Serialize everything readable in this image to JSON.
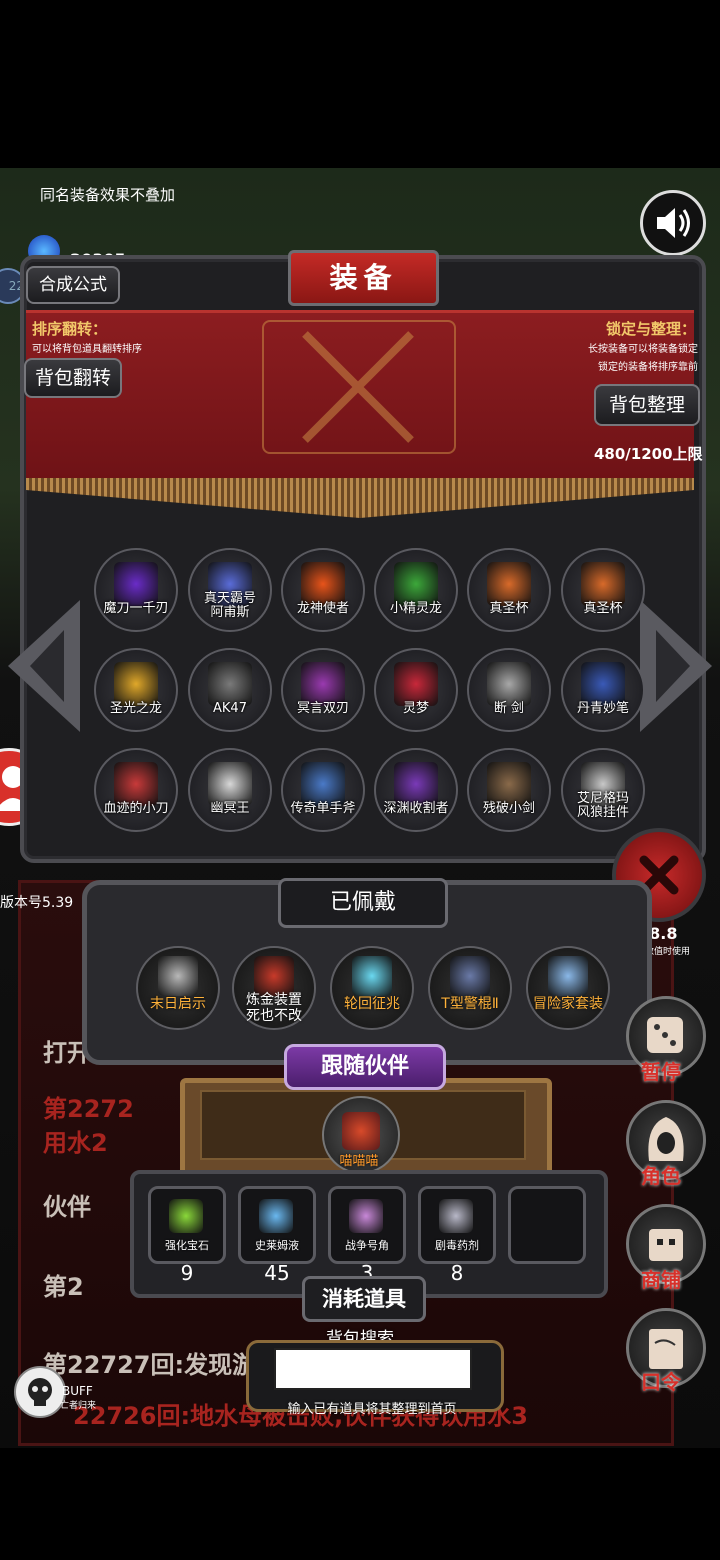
{
  "top_note": "同名装备效果不叠加",
  "currency": "20305",
  "level_badge": "22",
  "title": "装备",
  "buttons": {
    "recipe": "合成公式",
    "flip": "背包翻转",
    "tidy": "背包整理"
  },
  "sort_help": {
    "heading": "排序翻转：",
    "text": "可以将背包道具翻转排序"
  },
  "lock_help": {
    "heading": "锁定与整理：",
    "line1": "长按装备可以将装备锁定",
    "line2": "锁定的装备将排序靠前"
  },
  "capacity": "480/1200上限",
  "items": [
    {
      "name": "魔刀一千刃",
      "color": "#6a2cc8"
    },
    {
      "name": "真天霸号\n阿甫斯",
      "color": "#5a6cd8"
    },
    {
      "name": "龙神使者",
      "color": "#e8541a"
    },
    {
      "name": "小精灵龙",
      "color": "#3ca83a"
    },
    {
      "name": "真圣杯",
      "color": "#d86a2a"
    },
    {
      "name": "真圣杯",
      "color": "#d86a2a"
    },
    {
      "name": "圣光之龙",
      "color": "#e0a82a"
    },
    {
      "name": "AK47",
      "color": "#7a7a7a"
    },
    {
      "name": "冥言双刃",
      "color": "#9a3ab0"
    },
    {
      "name": "灵梦",
      "color": "#c8283a"
    },
    {
      "name": "断 剑",
      "color": "#a8a8a8"
    },
    {
      "name": "丹青妙笔",
      "color": "#3a5ab8"
    },
    {
      "name": "血迹的小刀",
      "color": "#c83a3a"
    },
    {
      "name": "幽冥王",
      "color": "#d8d8d8"
    },
    {
      "name": "传奇单手斧",
      "color": "#4a7ac8"
    },
    {
      "name": "深渊收割者",
      "color": "#7a3ab8"
    },
    {
      "name": "残破小剑",
      "color": "#8a6a4a"
    },
    {
      "name": "艾尼格玛\n风狼挂件",
      "color": "#c8c8c8"
    }
  ],
  "version": "版本号5.39",
  "worn": {
    "title": "已佩戴",
    "items": [
      {
        "name": "末日启示",
        "color": "#b8b8b8"
      },
      {
        "name": "炼金装置\n死也不改",
        "color": "#c83a2a"
      },
      {
        "name": "轮回征兆",
        "color": "#6ad8f0"
      },
      {
        "name": "T型警棍Ⅱ",
        "color": "#6a7aa8"
      },
      {
        "name": "冒险家套装",
        "color": "#8ab8e8"
      }
    ]
  },
  "partner": {
    "title": "跟随伙伴",
    "name": "喵喵喵"
  },
  "consumables": {
    "title": "消耗道具",
    "items": [
      {
        "name": "强化宝石",
        "count": "9",
        "color": "#8ad83a"
      },
      {
        "name": "史莱姆液",
        "count": "45",
        "color": "#6ab8f0"
      },
      {
        "name": "战争号角",
        "count": "3",
        "color": "#c888d8"
      },
      {
        "name": "剧毒药剂",
        "count": "8",
        "color": "#b8b8c8"
      }
    ]
  },
  "search": {
    "label": "背包搜索",
    "hint": "输入已有道具将其整理到首页",
    "value": ""
  },
  "side": {
    "pause": "暂停",
    "role": "角色",
    "shop": "商铺",
    "code": "口令",
    "stat_value": "38.8",
    "stat_note": "真数值时使用"
  },
  "log": {
    "line1": "打开",
    "line2": "第2272",
    "line3": "用水2",
    "line4": "伙伴",
    "line5": "第2",
    "line6": "第22727回:发现游",
    "line7": "22726回:地水母被击败,伙伴获得饮用水3"
  },
  "buff": {
    "label": "BUFF",
    "sub": "亡者归来"
  }
}
